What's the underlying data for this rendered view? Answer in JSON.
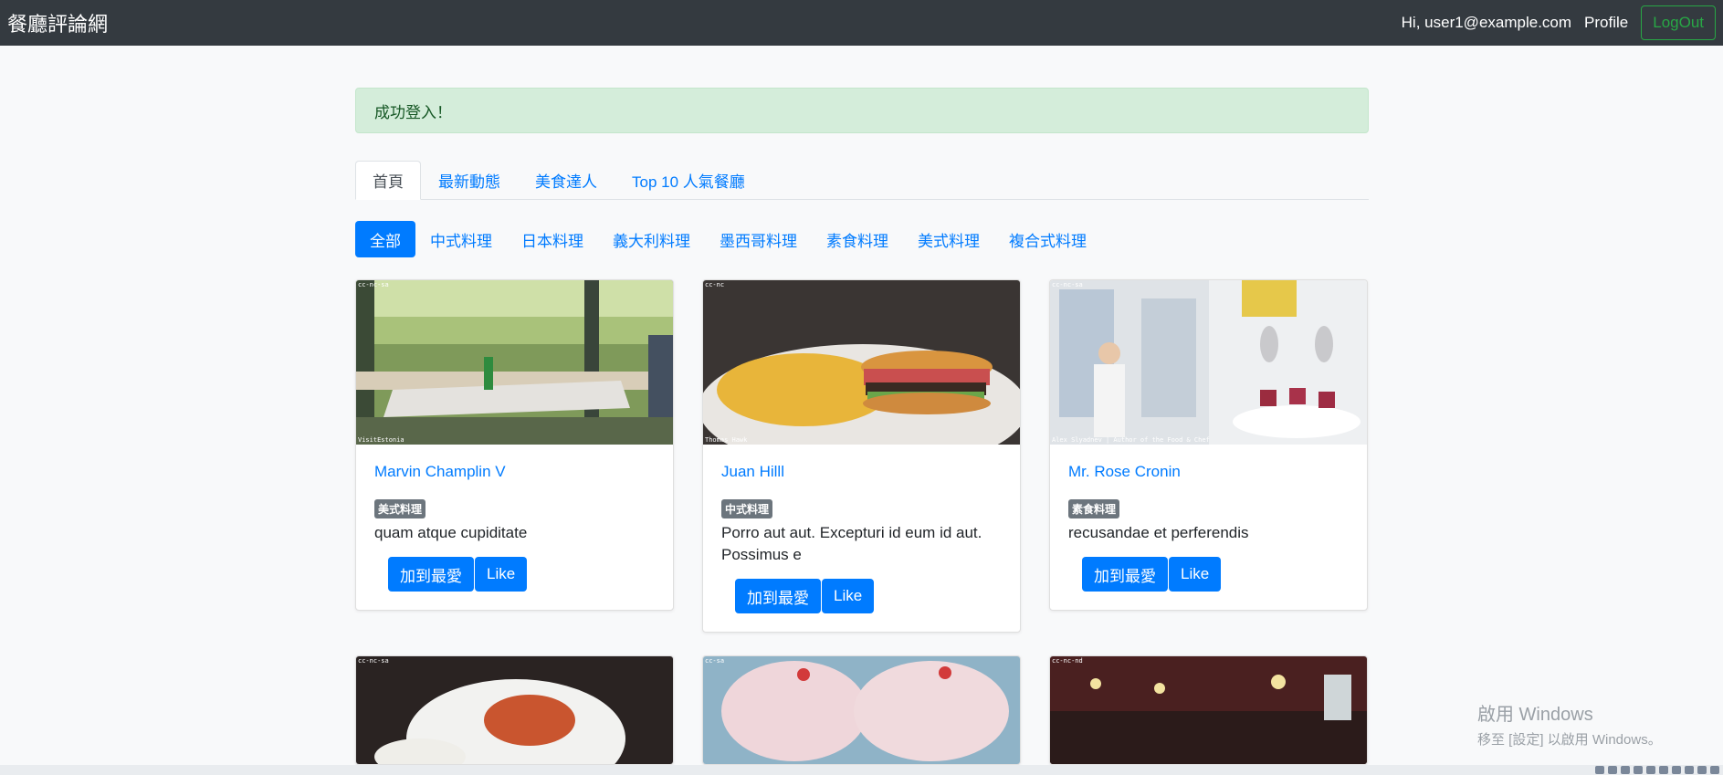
{
  "navbar": {
    "brand": "餐廳評論網",
    "greeting": "Hi, user1@example.com",
    "profile": "Profile",
    "logout": "LogOut"
  },
  "alert": {
    "message": "成功登入！"
  },
  "tabs": [
    {
      "label": "首頁",
      "active": true
    },
    {
      "label": "最新動態",
      "active": false
    },
    {
      "label": "美食達人",
      "active": false
    },
    {
      "label": "Top 10 人氣餐廳",
      "active": false
    }
  ],
  "categories": [
    {
      "label": "全部",
      "active": true
    },
    {
      "label": "中式料理"
    },
    {
      "label": "日本料理"
    },
    {
      "label": "義大利料理"
    },
    {
      "label": "墨西哥料理"
    },
    {
      "label": "素食料理"
    },
    {
      "label": "美式料理"
    },
    {
      "label": "複合式料理"
    }
  ],
  "restaurants": [
    {
      "name": "Marvin Champlin V",
      "category": "美式料理",
      "description": "quam atque cupiditate",
      "favorite_label": "加到最愛",
      "like_label": "Like",
      "image_top_label": "cc-nc-sa",
      "image_bottom_label": "VisitEstonia"
    },
    {
      "name": "Juan Hilll",
      "category": "中式料理",
      "description": "Porro aut aut. Excepturi id eum id aut. Possimus e",
      "favorite_label": "加到最愛",
      "like_label": "Like",
      "image_top_label": "cc-nc",
      "image_bottom_label": "Thomas Hawk"
    },
    {
      "name": "Mr. Rose Cronin",
      "category": "素食料理",
      "description": "recusandae et perferendis",
      "favorite_label": "加到最愛",
      "like_label": "Like",
      "image_top_label": "cc-nc-sa",
      "image_bottom_label": "Alex Slyadnev | Author of the Food & Chef"
    }
  ],
  "second_row_images": [
    {
      "image_top_label": "cc-nc-sa"
    },
    {
      "image_top_label": "cc-sa"
    },
    {
      "image_top_label": "cc-nc-nd"
    }
  ],
  "watermark": {
    "line1": "啟用 Windows",
    "line2": "移至 [設定] 以啟用 Windows。"
  }
}
